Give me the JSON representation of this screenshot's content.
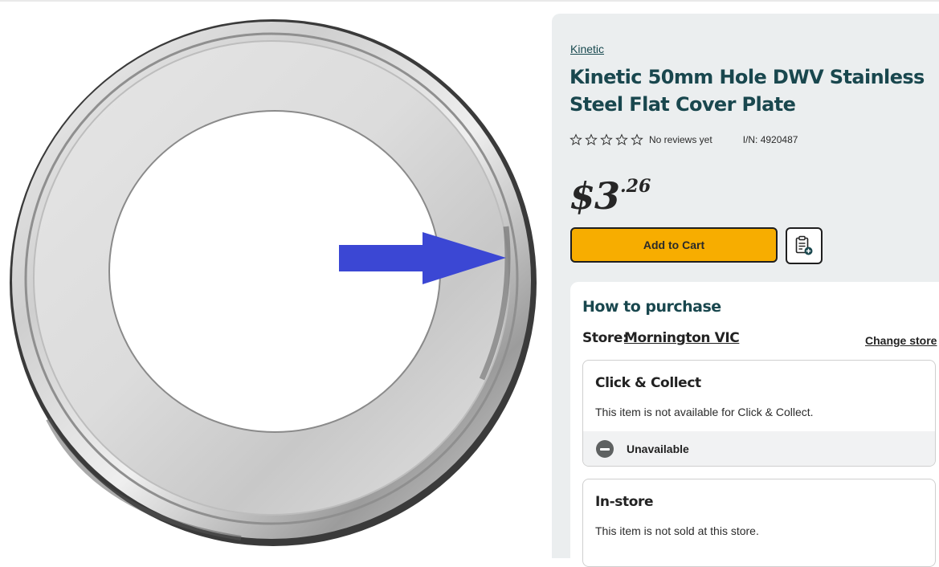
{
  "product": {
    "brand": "Kinetic",
    "title": "Kinetic 50mm Hole DWV Stainless Steel Flat Cover Plate",
    "rating_stars": 0,
    "reviews_text": "No reviews yet",
    "item_number": "I/N: 4920487",
    "price_dollars": "$3",
    "price_cents": ".26",
    "image_alt": "Stainless steel flat cover plate"
  },
  "actions": {
    "add_to_cart_label": "Add to Cart",
    "add_to_list_icon": "add-to-list-icon"
  },
  "purchase": {
    "heading": "How to purchase",
    "store_label": "Store:",
    "store_name": "Mornington VIC",
    "change_store_label": "Change store",
    "options": [
      {
        "title": "Click & Collect",
        "text": "This item is not available for Click & Collect.",
        "status": "Unavailable",
        "status_icon": "minus-circle-icon"
      },
      {
        "title": "In-store",
        "text": "This item is not sold at this store."
      }
    ]
  },
  "colors": {
    "accent_heading": "#19474e",
    "cart_button": "#f7ad00",
    "panel_background": "#ebeeef",
    "arrow": "#3b47d4"
  }
}
